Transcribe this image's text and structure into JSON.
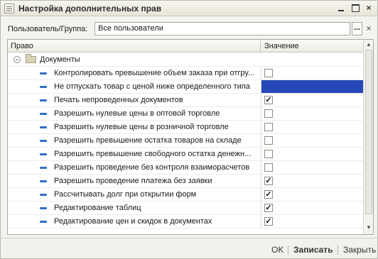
{
  "window": {
    "title": "Настройка дополнительных прав"
  },
  "user": {
    "label": "Пользователь/Группа:",
    "value": "Все пользователи",
    "select_label": "...",
    "clear_label": "×"
  },
  "table": {
    "columns": [
      "Право",
      "Значение"
    ],
    "rows": [
      {
        "name": "Документы",
        "type": "folder",
        "expanded": true
      },
      {
        "name": "Контролировать превышение объем заказа при отгру...",
        "checked": false
      },
      {
        "name": "Не отпускать товар с ценой ниже определенного типа",
        "checked": false,
        "selected": true
      },
      {
        "name": "Печать непроведенных документов",
        "checked": true
      },
      {
        "name": "Разрешить нулевые цены в оптовой торговле",
        "checked": false
      },
      {
        "name": "Разрешить нулевые цены в розничной торговле",
        "checked": false
      },
      {
        "name": "Разрешить превышение остатка товаров на складе",
        "checked": false
      },
      {
        "name": "Разрешить превышение свободного остатка денежн...",
        "checked": false
      },
      {
        "name": "Разрешить проведение без контроля взаиморасчетов",
        "checked": false
      },
      {
        "name": "Разрешить проведение платежа без заявки",
        "checked": true
      },
      {
        "name": "Рассчитывать долг при открытии форм",
        "checked": true
      },
      {
        "name": "Редактирование таблиц",
        "checked": true
      },
      {
        "name": "Редактирование цен и скидок в документах",
        "checked": true
      }
    ]
  },
  "footer": {
    "ok": "OK",
    "save": "Записать",
    "close": "Закрыть"
  },
  "colors": {
    "selection": "#2547b7",
    "bullet": "#2f6fc6"
  }
}
